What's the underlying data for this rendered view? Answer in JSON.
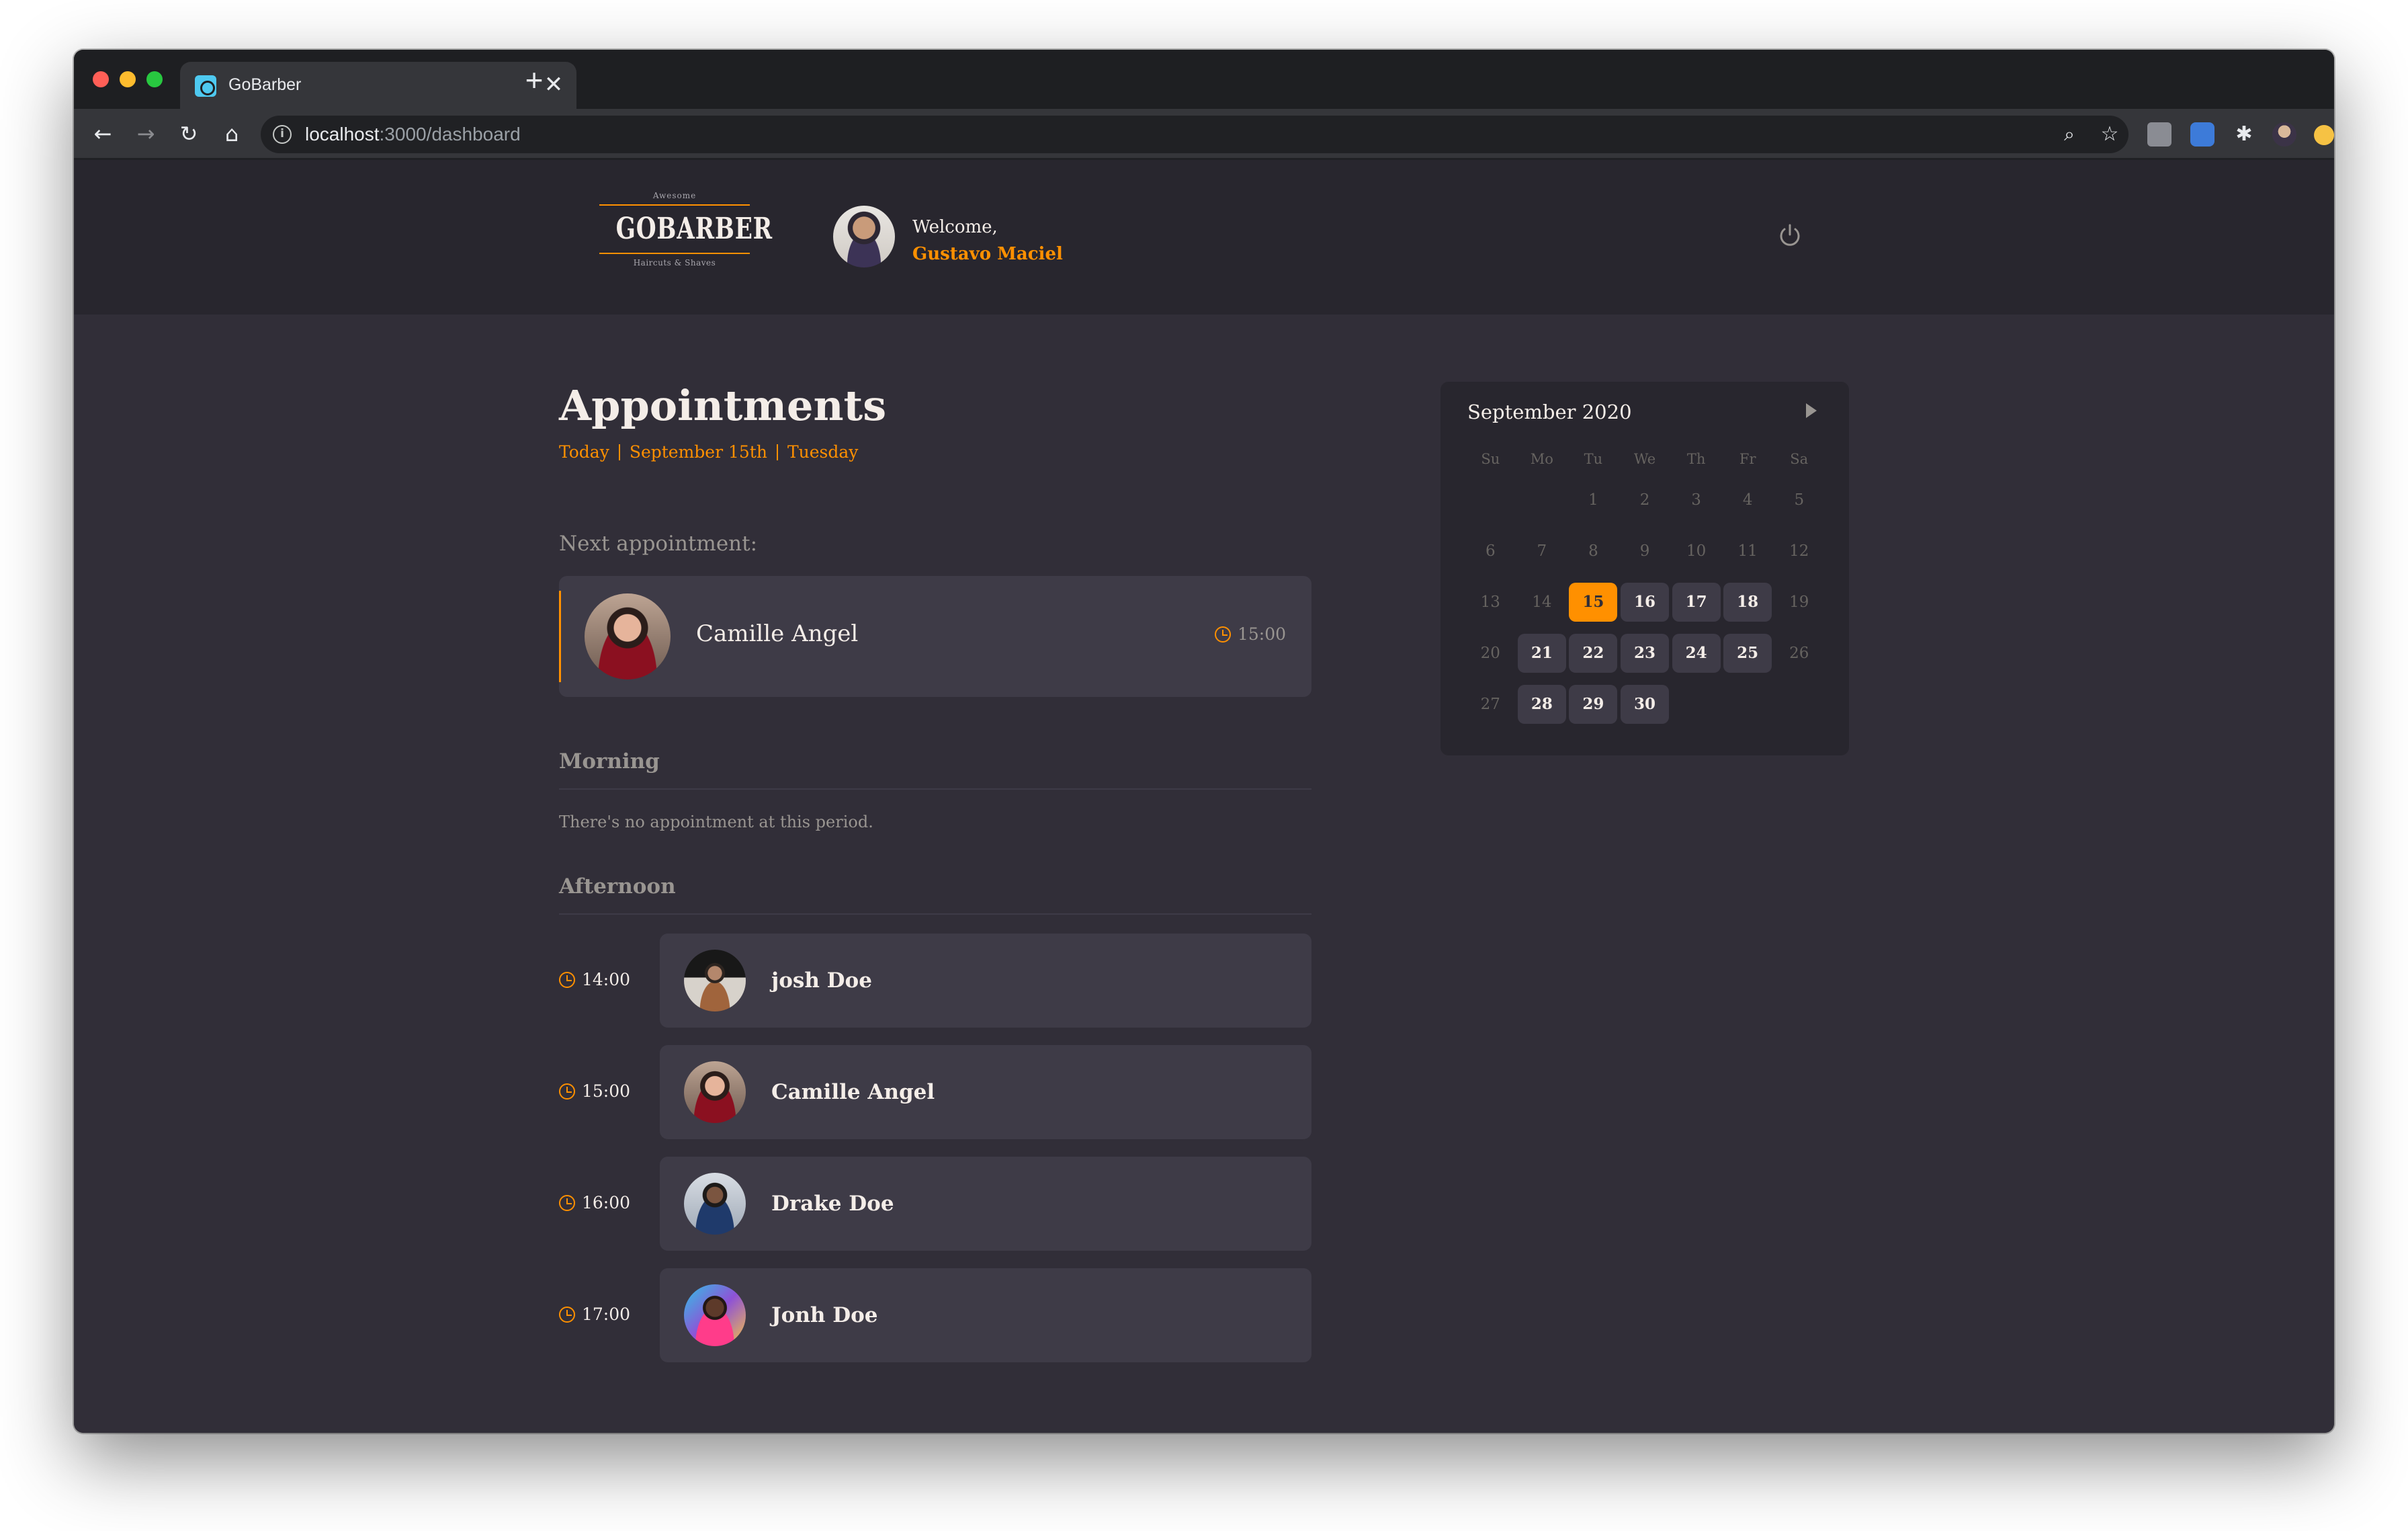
{
  "browser": {
    "tab_title": "GoBarber",
    "tab_close": "✕",
    "new_tab": "+",
    "url_host": "localhost",
    "url_path": ":3000/dashboard",
    "icons": [
      "back-icon",
      "forward-icon",
      "reload-icon",
      "home-icon",
      "info-icon",
      "zoom-icon",
      "bookmark-star-icon",
      "extension-icon",
      "profile-avatar-icon"
    ]
  },
  "header": {
    "logo_top": "Awesome",
    "logo_main": "GOBARBER",
    "logo_sub": "Haircuts & Shaves",
    "welcome": "Welcome,",
    "user_name": "Gustavo Maciel"
  },
  "schedule": {
    "title": "Appointments",
    "date_parts": [
      "Today",
      "September 15th",
      "Tuesday"
    ],
    "next_label": "Next appointment:",
    "next": {
      "name": "Camille Angel",
      "time": "15:00"
    },
    "morning_title": "Morning",
    "morning_empty": "There's no appointment at this period.",
    "afternoon_title": "Afternoon",
    "appointments": [
      {
        "time": "14:00",
        "name": "josh Doe"
      },
      {
        "time": "15:00",
        "name": "Camille Angel"
      },
      {
        "time": "16:00",
        "name": "Drake Doe"
      },
      {
        "time": "17:00",
        "name": "Jonh Doe"
      }
    ]
  },
  "calendar": {
    "month": "September 2020",
    "weekdays": [
      "Su",
      "Mo",
      "Tu",
      "We",
      "Th",
      "Fr",
      "Sa"
    ],
    "selected_day": "15",
    "weeks": [
      [
        "",
        "",
        "1",
        "2",
        "3",
        "4",
        "5"
      ],
      [
        "6",
        "7",
        "8",
        "9",
        "10",
        "11",
        "12"
      ],
      [
        "13",
        "14",
        "15",
        "16",
        "17",
        "18",
        "19"
      ],
      [
        "20",
        "21",
        "22",
        "23",
        "24",
        "25",
        "26"
      ],
      [
        "27",
        "28",
        "29",
        "30",
        "",
        "",
        ""
      ]
    ],
    "available_days": [
      "15",
      "16",
      "17",
      "18",
      "21",
      "22",
      "23",
      "24",
      "25",
      "28",
      "29",
      "30"
    ]
  },
  "colors": {
    "accent": "#ff9000",
    "background": "#312e38",
    "card": "#3e3b47",
    "header": "#28262e",
    "text": "#f4ede8",
    "muted": "#999591"
  }
}
